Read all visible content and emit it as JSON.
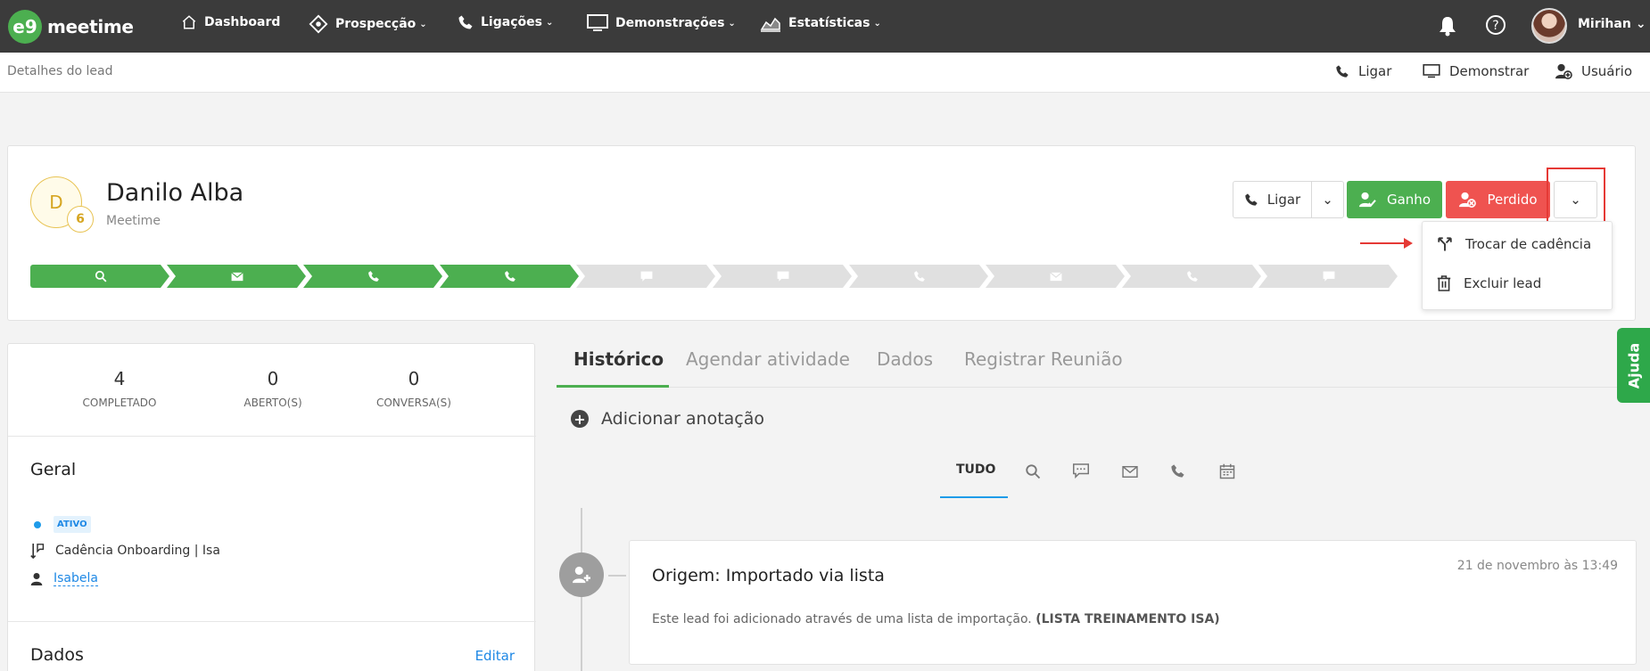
{
  "nav": {
    "logo_text": "meetime",
    "logo_mark": "e9",
    "items": [
      {
        "label": "Dashboard",
        "icon": "home-icon"
      },
      {
        "label": "Prospecção",
        "icon": "target-icon"
      },
      {
        "label": "Ligações",
        "icon": "phone-icon"
      },
      {
        "label": "Demonstrações",
        "icon": "monitor-icon"
      },
      {
        "label": "Estatísticas",
        "icon": "chart-icon"
      }
    ],
    "user": "Mirihan"
  },
  "subheader": {
    "title": "Detalhes do lead",
    "actions": [
      "Ligar",
      "Demonstrar",
      "Usuário"
    ]
  },
  "lead": {
    "initial": "D",
    "badge": "6",
    "name": "Danilo Alba",
    "company": "Meetime",
    "buttons": {
      "call": "Ligar",
      "won": "Ganho",
      "lost": "Perdido"
    },
    "colors": {
      "won": "#4caf50",
      "lost": "#ef5350",
      "done_step": "#4caf50",
      "todo_step": "#e0e0e0"
    },
    "steps_completed": 4,
    "steps_total": 10
  },
  "menu": {
    "items": [
      "Trocar de cadência",
      "Excluir lead"
    ]
  },
  "stats": [
    {
      "value": "4",
      "label": "COMPLETADO"
    },
    {
      "value": "0",
      "label": "ABERTO(S)"
    },
    {
      "value": "0",
      "label": "CONVERSA(S)"
    }
  ],
  "general": {
    "title": "Geral",
    "status": "ATIVO",
    "cadence": "Cadência Onboarding | Isa",
    "owner": "Isabela"
  },
  "data_section": {
    "title": "Dados",
    "edit": "Editar"
  },
  "tabs": [
    "Histórico",
    "Agendar atividade",
    "Dados",
    "Registrar Reunião"
  ],
  "add_note": "Adicionar anotação",
  "filter": {
    "all": "TUDO"
  },
  "event": {
    "title": "Origem: Importado via lista",
    "date": "21 de novembro às 13:49",
    "desc": "Este lead foi adicionado através de uma lista de importação.",
    "desc_bold": "(LISTA TREINAMENTO ISA)"
  },
  "help": "Ajuda"
}
